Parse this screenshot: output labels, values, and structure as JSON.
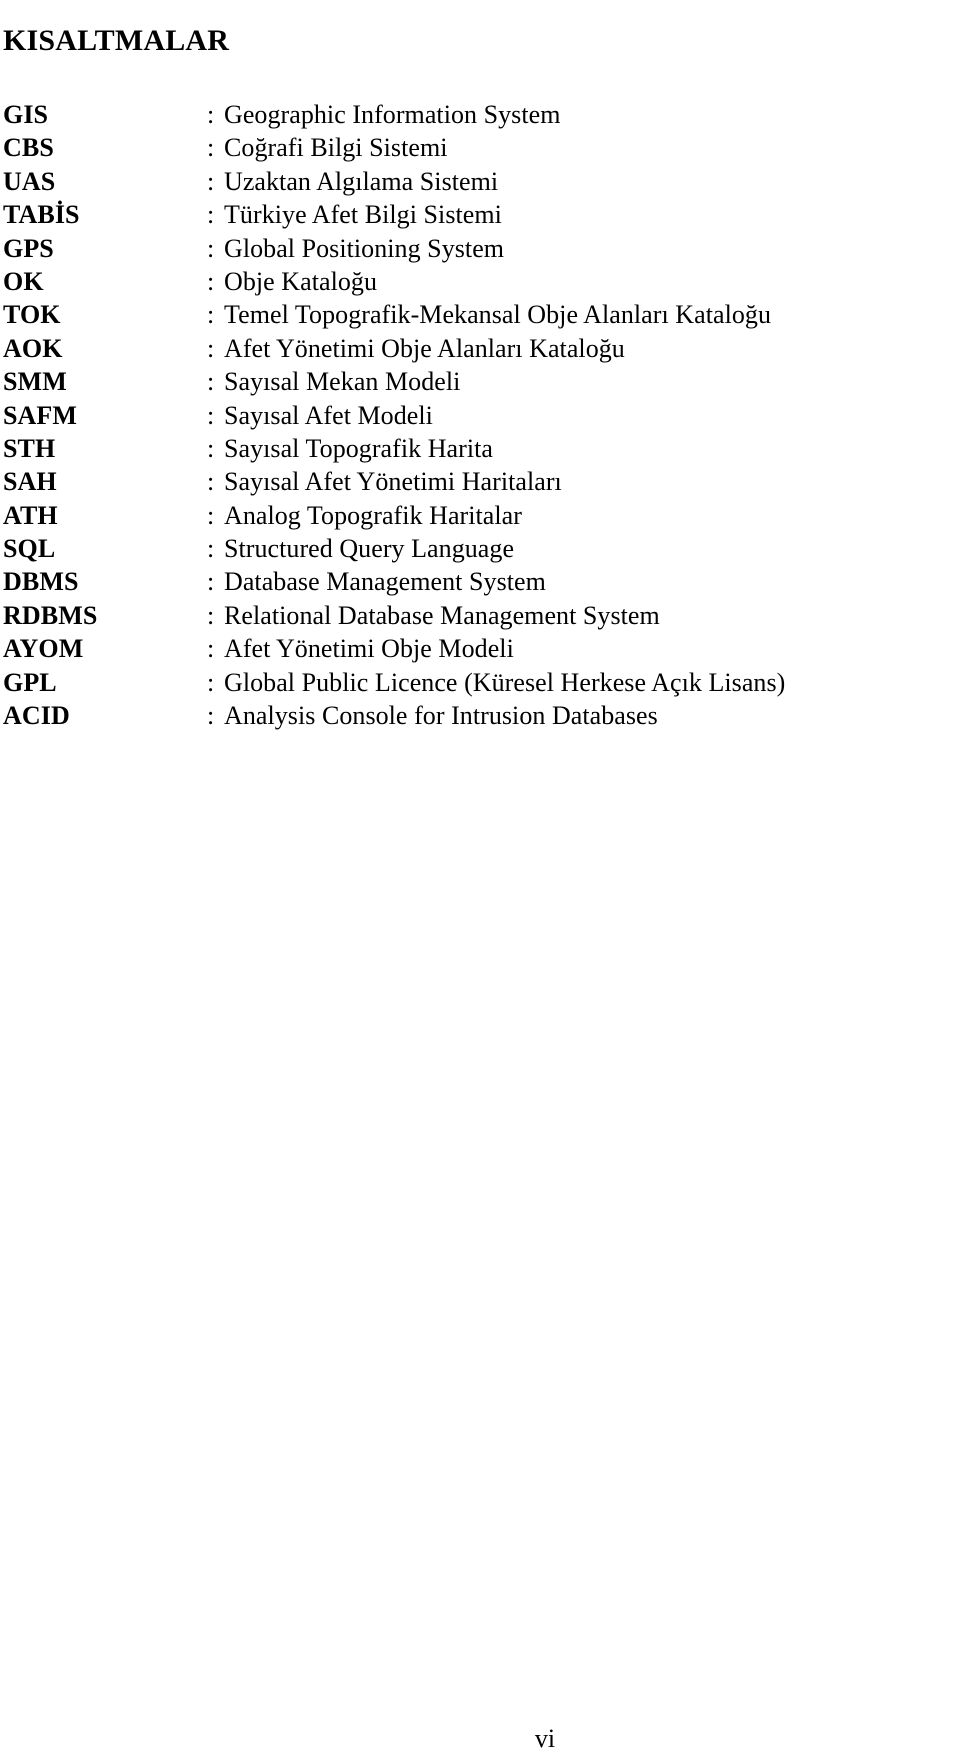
{
  "document": {
    "heading": "KISALTMALAR",
    "page_number": "vi",
    "separator": ":"
  },
  "abbreviations": [
    {
      "term": "GIS",
      "definition": "Geographic Information System"
    },
    {
      "term": "CBS",
      "definition": "Coğrafi Bilgi Sistemi"
    },
    {
      "term": "UAS",
      "definition": "Uzaktan Algılama Sistemi"
    },
    {
      "term": "TABİS",
      "definition": "Türkiye Afet Bilgi Sistemi"
    },
    {
      "term": "GPS",
      "definition": "Global Positioning System"
    },
    {
      "term": "OK",
      "definition": "Obje Kataloğu"
    },
    {
      "term": "TOK",
      "definition": "Temel Topografik-Mekansal Obje Alanları Kataloğu"
    },
    {
      "term": "AOK",
      "definition": "Afet Yönetimi Obje Alanları Kataloğu"
    },
    {
      "term": "SMM",
      "definition": "Sayısal Mekan Modeli"
    },
    {
      "term": "SAFM",
      "definition": "Sayısal Afet Modeli"
    },
    {
      "term": "STH",
      "definition": "Sayısal Topografik Harita"
    },
    {
      "term": "SAH",
      "definition": "Sayısal Afet Yönetimi Haritaları"
    },
    {
      "term": "ATH",
      "definition": "Analog Topografik Haritalar"
    },
    {
      "term": "SQL",
      "definition": "Structured Query Language"
    },
    {
      "term": "DBMS",
      "definition": "Database Management System"
    },
    {
      "term": "RDBMS",
      "definition": "Relational Database Management System"
    },
    {
      "term": "AYOM",
      "definition": "Afet Yönetimi Obje Modeli"
    },
    {
      "term": "GPL",
      "definition": "Global Public Licence (Küresel Herkese Açık Lisans)"
    },
    {
      "term": "ACID",
      "definition": "Analysis Console for Intrusion Databases"
    }
  ]
}
